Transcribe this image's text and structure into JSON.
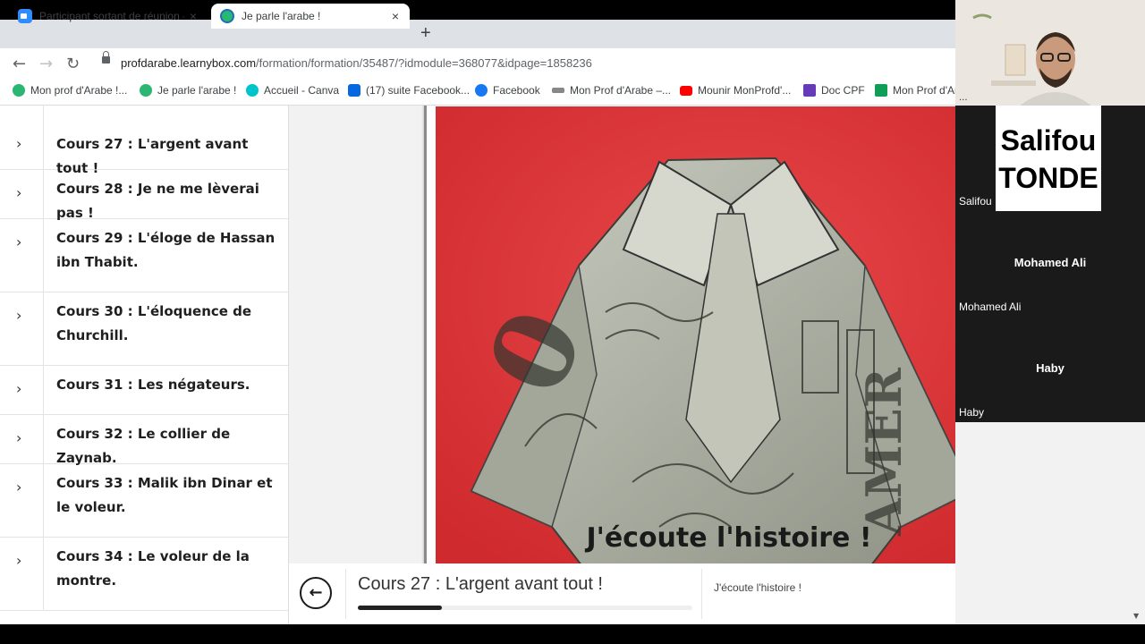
{
  "browser": {
    "tabs": [
      {
        "title": "Participant sortant de réunion - Z",
        "icon": "zoom-icon",
        "active": false
      },
      {
        "title": "Je parle l'arabe !",
        "icon": "globe-icon",
        "active": true
      }
    ],
    "new_tab_symbol": "+",
    "close_symbol": "×",
    "url_host": "profdarabe.learnybox.com",
    "url_path": "/formation/formation/35487/?idmodule=368077&idpage=1858236",
    "bookmarks": [
      {
        "label": "Mon prof d'Arabe !...",
        "icon": "globe-icon",
        "color": "#2bb673"
      },
      {
        "label": "Je parle l'arabe !",
        "icon": "globe-icon",
        "color": "#2bb673"
      },
      {
        "label": "Accueil - Canva",
        "icon": "canva-icon",
        "color": "#00c4cc"
      },
      {
        "label": "(17) suite Facebook...",
        "icon": "meta-icon",
        "color": "#0668e1"
      },
      {
        "label": "Facebook",
        "icon": "facebook-icon",
        "color": "#1877f2"
      },
      {
        "label": "Mon Prof d'Arabe –...",
        "icon": "site-icon",
        "color": "#888888"
      },
      {
        "label": "Mounir MonProfd'...",
        "icon": "youtube-icon",
        "color": "#ff0000"
      },
      {
        "label": "Doc CPF",
        "icon": "forms-icon",
        "color": "#673ab7"
      },
      {
        "label": "Mon Prof d'Ar",
        "icon": "sheets-icon",
        "color": "#0f9d58"
      }
    ]
  },
  "sidebar": {
    "items": [
      {
        "label": "Cours 27 : L'argent avant tout !"
      },
      {
        "label": "Cours 28 : Je ne me lèverai pas !"
      },
      {
        "label": "Cours 29 : L'éloge de Hassan ibn Thabit."
      },
      {
        "label": "Cours 30 : L'éloquence de Churchill."
      },
      {
        "label": "Cours 31 : Les négateurs."
      },
      {
        "label": "Cours 32 : Le collier de Zaynab."
      },
      {
        "label": "Cours 33 : Malik ibn Dinar et le voleur."
      },
      {
        "label": "Cours 34 : Le voleur de la montre."
      }
    ]
  },
  "content": {
    "image_subject": "Origami shirt folded from a dollar bill on a red background",
    "heading": "J'écoute l'histoire !"
  },
  "bottom_bar": {
    "course_title": "Cours 27 : L'argent avant tout !",
    "progress": 0.25,
    "next_label": "J'écoute l'histoire !",
    "prev_icon": "arrow-left-icon",
    "next_icon": "arrow-right-icon"
  },
  "video_panel": {
    "dots": "...",
    "participants": [
      {
        "card_text_line1": "Salifou",
        "card_text_line2": "TONDE",
        "name": "Salifou"
      },
      {
        "center_name": "Mohamed Ali",
        "name": "Mohamed Ali"
      },
      {
        "center_name": "Haby",
        "name": "Haby"
      }
    ]
  },
  "colors": {
    "accent_dark": "#1a1a1a",
    "photo_bg": "#e04040",
    "page_bg": "#f2f2f2"
  }
}
